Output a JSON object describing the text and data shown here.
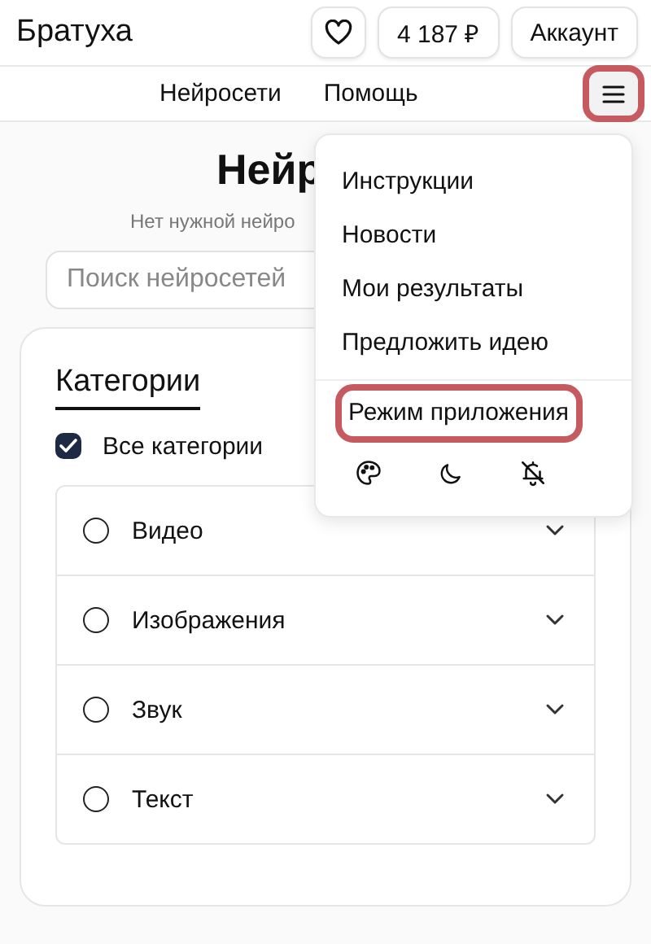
{
  "header": {
    "brand": "Братуха",
    "balance": "4 187 ₽",
    "account": "Аккаунт"
  },
  "nav": {
    "links": [
      "Нейросети",
      "Помощь"
    ],
    "menu_button": {
      "highlighted": true
    }
  },
  "page": {
    "title": "Нейр",
    "subtitle": "Нет нужной нейро",
    "search": {
      "placeholder": "Поиск нейросетей"
    }
  },
  "categories": {
    "title": "Категории",
    "all": {
      "label": "Все категории",
      "checked": true
    },
    "items": [
      {
        "label": "Видео",
        "checked": false
      },
      {
        "label": "Изображения",
        "checked": false
      },
      {
        "label": "Звук",
        "checked": false
      },
      {
        "label": "Текст",
        "checked": false
      }
    ]
  },
  "menu": {
    "items": [
      {
        "label": "Инструкции",
        "highlighted": false
      },
      {
        "label": "Новости",
        "highlighted": false
      },
      {
        "label": "Мои результаты",
        "highlighted": false
      },
      {
        "label": "Предложить идею",
        "highlighted": false
      }
    ],
    "mode_item": {
      "label": "Режим приложения",
      "highlighted": true
    }
  }
}
